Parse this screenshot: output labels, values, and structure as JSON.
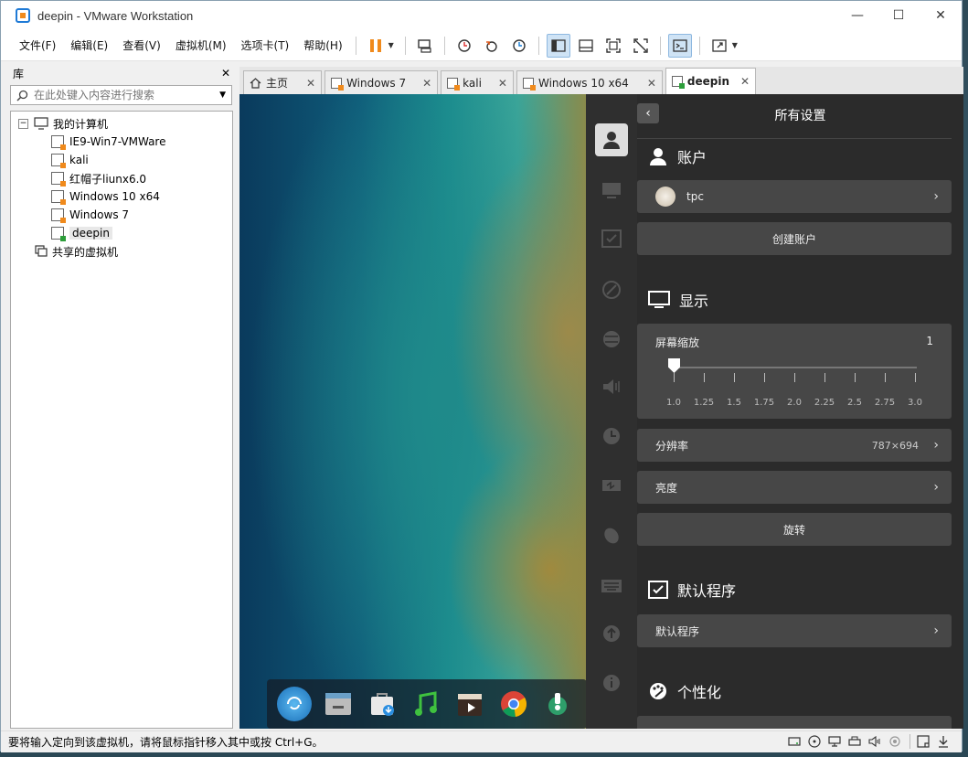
{
  "window": {
    "title": "deepin - VMware Workstation",
    "min": "—",
    "max": "☐",
    "close": "✕"
  },
  "menu": [
    "文件(F)",
    "编辑(E)",
    "查看(V)",
    "虚拟机(M)",
    "选项卡(T)",
    "帮助(H)"
  ],
  "library": {
    "title": "库",
    "close": "✕",
    "search_placeholder": "在此处键入内容进行搜索",
    "root": "我的计算机",
    "vms": [
      "IE9-Win7-VMWare",
      "kali",
      "红帽子liunx6.0",
      "Windows 10 x64",
      "Windows 7",
      "deepin"
    ],
    "selected": "deepin",
    "shared": "共享的虚拟机"
  },
  "tabs": [
    {
      "label": "主页",
      "close": "✕"
    },
    {
      "label": "Windows 7",
      "close": "✕"
    },
    {
      "label": "kali",
      "close": "✕"
    },
    {
      "label": "Windows 10 x64",
      "close": "✕"
    },
    {
      "label": "deepin",
      "close": "✕"
    }
  ],
  "settings": {
    "header": "所有设置",
    "back": "‹",
    "account": {
      "title": "账户",
      "user": "tpc",
      "create": "创建账户"
    },
    "display": {
      "title": "显示",
      "scale_label": "屏幕缩放",
      "scale_value": "1",
      "scale_ticks": [
        "1.0",
        "1.25",
        "1.5",
        "1.75",
        "2.0",
        "2.25",
        "2.5",
        "2.75",
        "3.0"
      ],
      "resolution_label": "分辨率",
      "resolution_value": "787×694",
      "brightness": "亮度",
      "rotate": "旋转"
    },
    "default_apps": {
      "title": "默认程序",
      "row": "默认程序"
    },
    "personalization": {
      "title": "个性化"
    }
  },
  "status": {
    "text": "要将输入定向到该虚拟机，请将鼠标指针移入其中或按 Ctrl+G。"
  },
  "colors": {
    "settings_bg": "#2b2b2b",
    "row_bg": "#474747",
    "accent_orange": "#f08a1c"
  }
}
